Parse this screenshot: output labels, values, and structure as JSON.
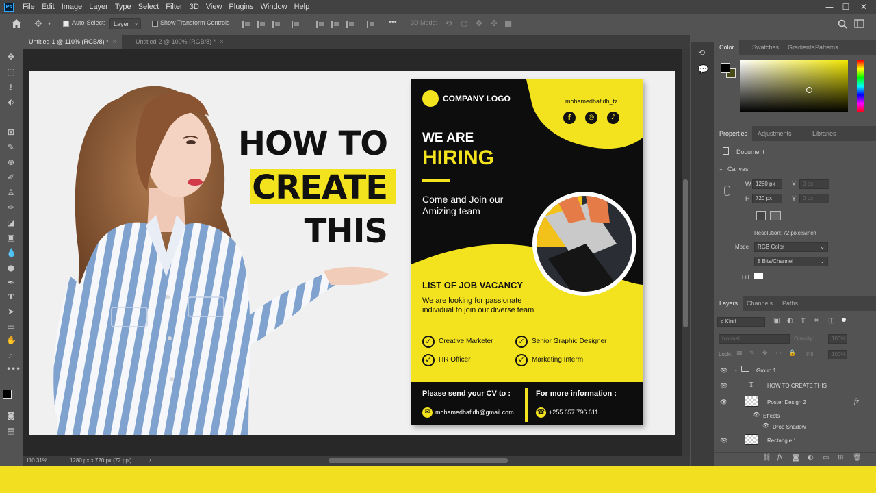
{
  "menu": [
    "File",
    "Edit",
    "Image",
    "Layer",
    "Type",
    "Select",
    "Filter",
    "3D",
    "View",
    "Plugins",
    "Window",
    "Help"
  ],
  "window_controls": {
    "minimize": "—",
    "maximize": "☐",
    "close": "✕"
  },
  "options": {
    "auto_select_label": "Auto-Select:",
    "auto_select_value": "Layer",
    "transform_label": "Show Transform Controls",
    "mode_label": "3D Mode:",
    "more": "•••"
  },
  "tabs": [
    {
      "label": "Untitled-1 @ 110% (RGB/8) *",
      "close": "×"
    },
    {
      "label": "Untitled-2 @ 100% (RGB/8) *",
      "close": "×"
    }
  ],
  "status": {
    "zoom": "110.31%",
    "doc_info": "1280 px x 720 px (72 ppi)",
    "arrow": "›"
  },
  "canvas": {
    "headline": [
      "HOW TO",
      "CREATE",
      "THIS"
    ],
    "highlight_color": "#f3e31f"
  },
  "poster": {
    "logo": "COMPANY LOGO",
    "handle": "mohamedhafidh_tz",
    "social_icons": [
      "facebook-icon",
      "instagram-icon",
      "tiktok-icon"
    ],
    "social_glyphs": [
      "f",
      "◎",
      "♪"
    ],
    "we_are": "WE ARE",
    "hiring": "HIRING",
    "join": [
      "Come and Join our",
      "Amizing team"
    ],
    "vacancy_title": "LIST OF JOB VACANCY",
    "vacancy_desc": [
      "We are looking for passionate",
      "individual to join our diverse team"
    ],
    "jobs": [
      "Creative Marketer",
      "Senior Graphic Designer",
      "HR Officer",
      "Marketing Interm"
    ],
    "check_glyph": "✓",
    "cv_label": "Please send your CV to :",
    "email": "mohamedhafidh@gmail.com",
    "info_label": "For more information :",
    "phone": "+255 657 796 611",
    "accent": "#f3e31f"
  },
  "color_panel": {
    "tabs": [
      "Color",
      "Swatches",
      "Gradients",
      "Patterns"
    ]
  },
  "properties_panel": {
    "tabs": [
      "Properties",
      "Adjustments",
      "Libraries"
    ],
    "document_label": "Document",
    "section": "Canvas",
    "w_label": "W",
    "w_value": "1280 px",
    "h_label": "H",
    "h_value": "720 px",
    "x_label": "X",
    "x_value": "0 px",
    "y_label": "Y",
    "y_value": "0 px",
    "resolution": "Resolution: 72 pixels/inch",
    "mode_label": "Mode",
    "mode_value": "RGB Color",
    "bits_value": "8 Bits/Channel",
    "fill_label": "Fill"
  },
  "layers_panel": {
    "tabs": [
      "Layers",
      "Channels",
      "Paths"
    ],
    "filter": "Kind",
    "blend": "Normal",
    "opacity_label": "Opacity:",
    "opacity_value": "100%",
    "lock_label": "Lock:",
    "fill_label": "Fill:",
    "fill_value": "100%",
    "layers": [
      {
        "name": "Group 1"
      },
      {
        "name": "HOW TO CREATE THIS"
      },
      {
        "name": "Poster Design 2",
        "fx": "fx"
      },
      {
        "name": "Effects"
      },
      {
        "name": "Drop Shadow"
      },
      {
        "name": "Rectangle 1"
      }
    ]
  }
}
